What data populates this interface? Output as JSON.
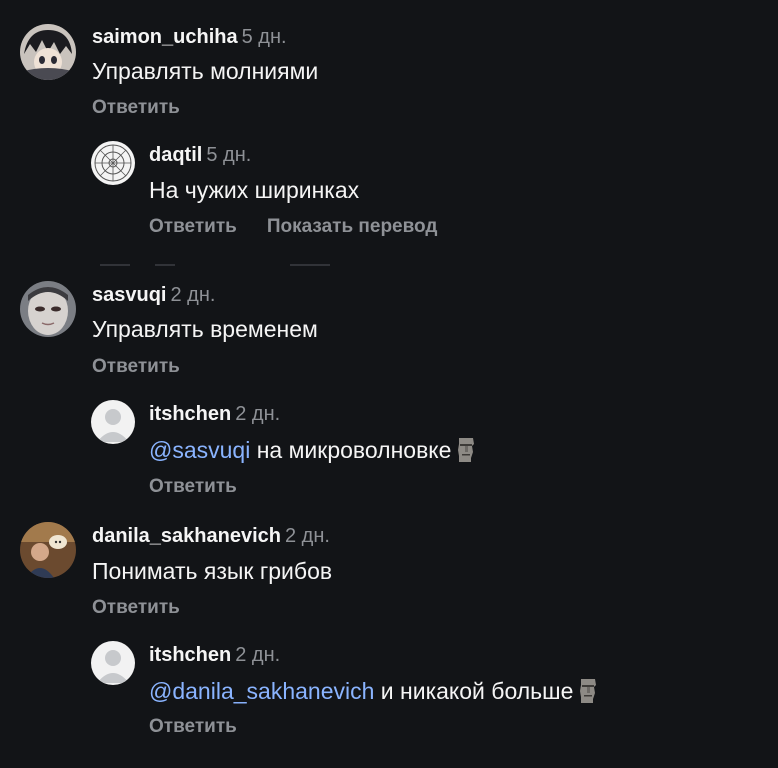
{
  "comments": [
    {
      "username": "saimon_uchiha",
      "age": "5 дн.",
      "text": "Управлять молниями",
      "reply_label": "Ответить",
      "replies": [
        {
          "username": "daqtil",
          "age": "5 дн.",
          "text": "На чужих ширинках",
          "reply_label": "Ответить",
          "translate_label": "Показать перевод"
        }
      ]
    },
    {
      "username": "sasvuqi",
      "age": "2 дн.",
      "text": "Управлять временем",
      "reply_label": "Ответить",
      "replies": [
        {
          "username": "itshchen",
          "age": "2 дн.",
          "mention": "@sasvuqi",
          "text": " на микроволновке",
          "emoji": "moai-emoji",
          "reply_label": "Ответить"
        }
      ]
    },
    {
      "username": "danila_sakhanevich",
      "age": "2 дн.",
      "text": "Понимать язык грибов",
      "reply_label": "Ответить",
      "replies": [
        {
          "username": "itshchen",
          "age": "2 дн.",
          "mention": "@danila_sakhanevich",
          "text": " и никакой больше",
          "emoji": "moai-emoji",
          "reply_label": "Ответить"
        }
      ]
    }
  ],
  "colors": {
    "background": "#121417",
    "text": "#f5f5f5",
    "secondary": "#8e9196",
    "mention": "#8ab4ff"
  }
}
